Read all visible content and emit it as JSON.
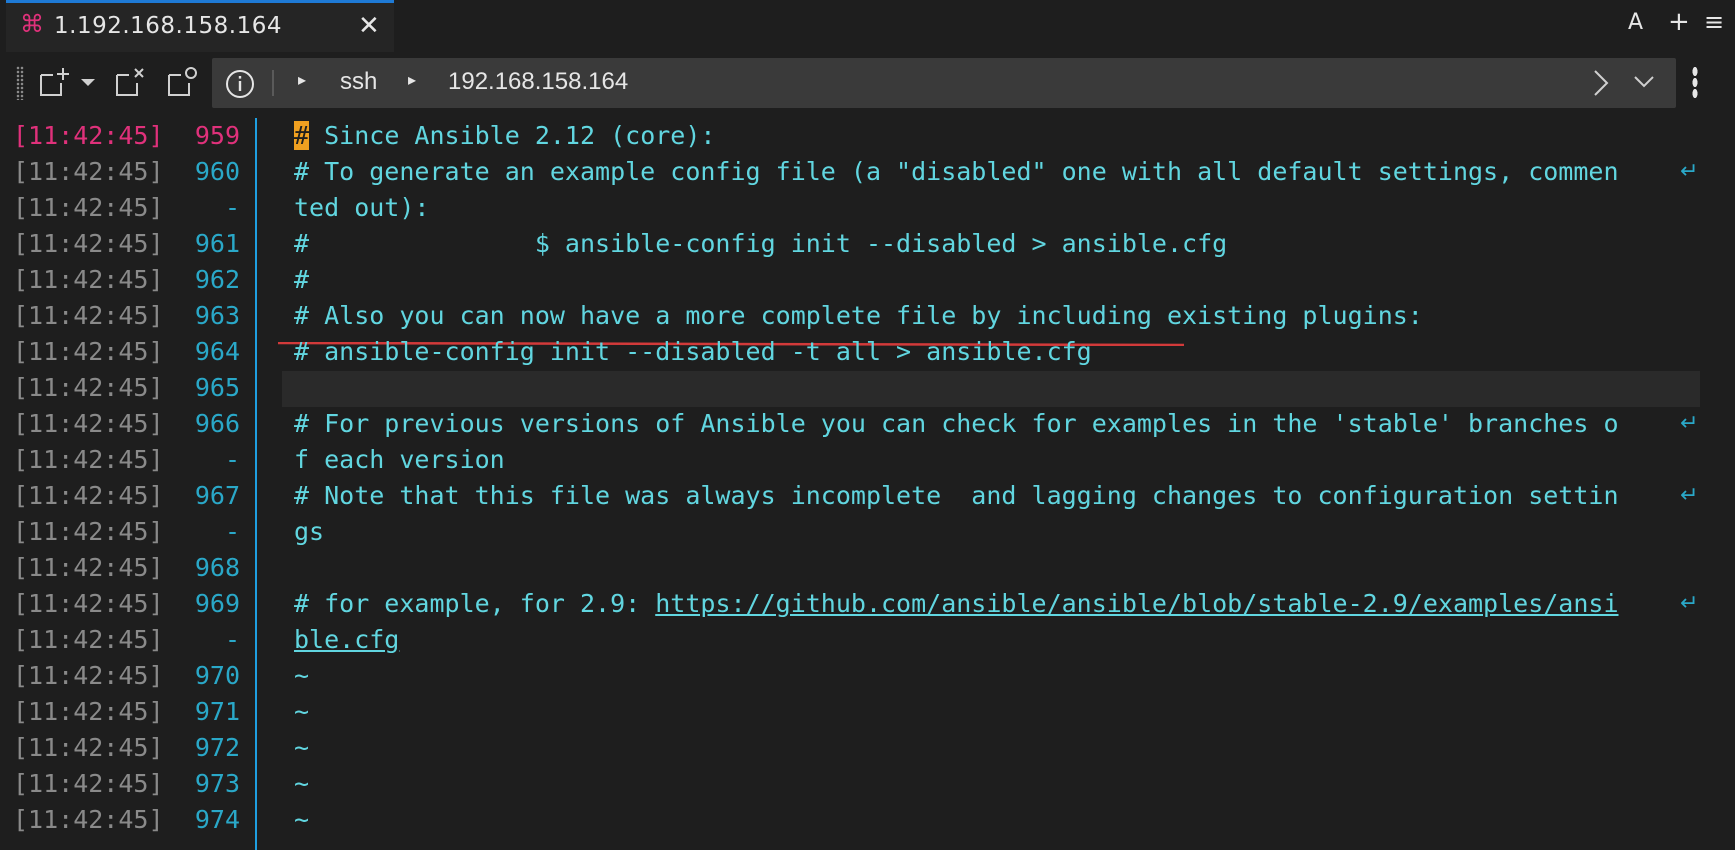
{
  "tab": {
    "icon": "command-icon",
    "title": "1.192.168.158.164",
    "close_glyph": "✕"
  },
  "tabbar_actions": {
    "font_label": "A",
    "add_label": "+",
    "menu_label": "≡"
  },
  "toolbar": {
    "address": {
      "protocol": "ssh",
      "host": "192.168.158.164"
    }
  },
  "colors": {
    "accent_blue": "#1e7ad6",
    "pink": "#e0317b",
    "cyan_text": "#61d6e0",
    "line_number": "#2aa8c8",
    "cursor": "#f0a020",
    "underline_red": "#d23a3a"
  },
  "terminal": {
    "rows": [
      {
        "ts": "[11:42:45]",
        "ln": "959",
        "cursor": "#",
        "text": " Since Ansible 2.12 (core):",
        "wrap": ""
      },
      {
        "ts": "[11:42:45]",
        "ln": "960",
        "text": "# To generate an example config file (a \"disabled\" one with all default settings, commen",
        "wrap": "↵"
      },
      {
        "ts": "[11:42:45]",
        "ln": "-",
        "text": "ted out):",
        "wrap": ""
      },
      {
        "ts": "[11:42:45]",
        "ln": "961",
        "text": "#               $ ansible-config init --disabled > ansible.cfg",
        "wrap": ""
      },
      {
        "ts": "[11:42:45]",
        "ln": "962",
        "text": "#",
        "wrap": ""
      },
      {
        "ts": "[11:42:45]",
        "ln": "963",
        "text": "# Also you can now have a more complete file by including existing plugins:",
        "wrap": ""
      },
      {
        "ts": "[11:42:45]",
        "ln": "964",
        "text": "# ansible-config init --disabled -t all > ansible.cfg",
        "wrap": ""
      },
      {
        "ts": "[11:42:45]",
        "ln": "965",
        "text": "",
        "wrap": ""
      },
      {
        "ts": "[11:42:45]",
        "ln": "966",
        "text": "# For previous versions of Ansible you can check for examples in the 'stable' branches o",
        "wrap": "↵"
      },
      {
        "ts": "[11:42:45]",
        "ln": "-",
        "text": "f each version",
        "wrap": ""
      },
      {
        "ts": "[11:42:45]",
        "ln": "967",
        "text": "# Note that this file was always incomplete  and lagging changes to configuration settin",
        "wrap": "↵"
      },
      {
        "ts": "[11:42:45]",
        "ln": "-",
        "text": "gs",
        "wrap": ""
      },
      {
        "ts": "[11:42:45]",
        "ln": "968",
        "text": "",
        "wrap": ""
      },
      {
        "ts": "[11:42:45]",
        "ln": "969",
        "text": "# for example, for 2.9: ",
        "link": "https://github.com/ansible/ansible/blob/stable-2.9/examples/ansi",
        "wrap": "↵"
      },
      {
        "ts": "[11:42:45]",
        "ln": "-",
        "link": "ble.cfg",
        "text": "",
        "wrap": ""
      },
      {
        "ts": "[11:42:45]",
        "ln": "970",
        "text": "~",
        "wrap": ""
      },
      {
        "ts": "[11:42:45]",
        "ln": "971",
        "text": "~",
        "wrap": ""
      },
      {
        "ts": "[11:42:45]",
        "ln": "972",
        "text": "~",
        "wrap": ""
      },
      {
        "ts": "[11:42:45]",
        "ln": "973",
        "text": "~",
        "wrap": ""
      },
      {
        "ts": "[11:42:45]",
        "ln": "974",
        "text": "~",
        "wrap": ""
      }
    ]
  }
}
